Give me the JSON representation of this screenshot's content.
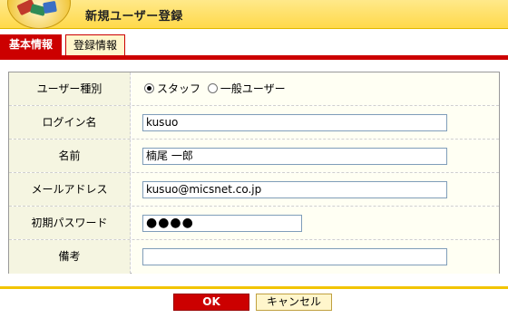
{
  "header": {
    "title": "新規ユーザー登録"
  },
  "tabs": [
    {
      "label": "基本情報",
      "active": true
    },
    {
      "label": "登録情報",
      "active": false
    }
  ],
  "form": {
    "user_type": {
      "label": "ユーザー種別",
      "options": [
        {
          "label": "スタッフ",
          "checked": true
        },
        {
          "label": "一般ユーザー",
          "checked": false
        }
      ]
    },
    "login_name": {
      "label": "ログイン名",
      "value": "kusuo"
    },
    "name": {
      "label": "名前",
      "value": "楠尾 一郎"
    },
    "email": {
      "label": "メールアドレス",
      "value": "kusuo@micsnet.co.jp"
    },
    "password": {
      "label": "初期パスワード",
      "value": "●●●●"
    },
    "remarks": {
      "label": "備考",
      "value": ""
    }
  },
  "buttons": {
    "ok": "OK",
    "cancel": "キャンセル"
  },
  "colors": {
    "accent_red": "#cc0000",
    "header_yellow": "#ffd94a",
    "label_bg": "#f5f5e1"
  }
}
